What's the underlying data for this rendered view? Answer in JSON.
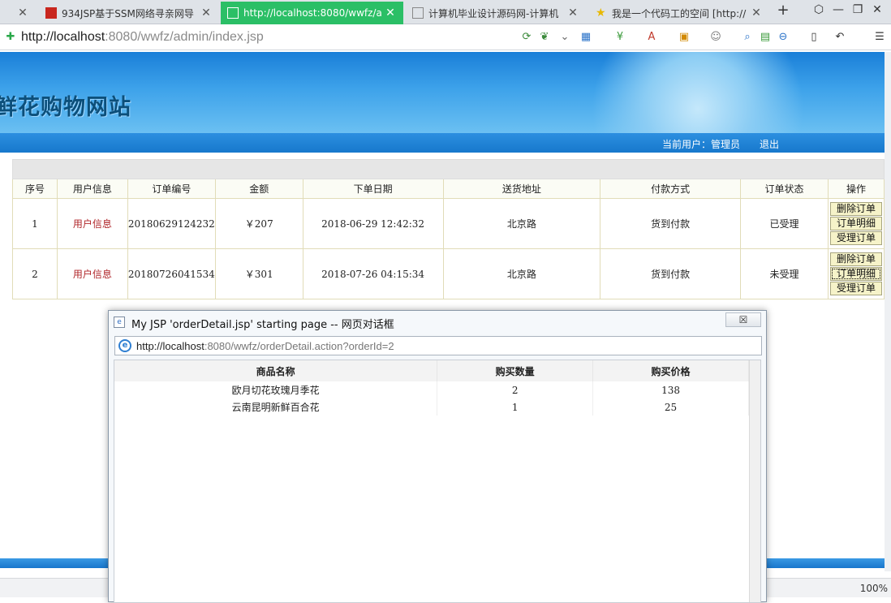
{
  "browser": {
    "tabs": [
      {
        "label": "934JSP基于SSM网络寻亲网导",
        "active": false
      },
      {
        "label": "http://localhost:8080/wwfz/a",
        "active": true
      },
      {
        "label": "计算机毕业设计源码网-计算机",
        "active": false
      },
      {
        "label": "我是一个代码工的空间 [http://",
        "active": false
      }
    ],
    "new_tab": "+",
    "address_host": "http://localhost",
    "address_rest": ":8080/wwfz/admin/index.jsp",
    "zoom": "100%"
  },
  "site": {
    "title": "鲜花购物网站",
    "current_user_label": "当前用户：管理员",
    "logout": "退出"
  },
  "orders": {
    "columns": [
      "序号",
      "用户信息",
      "订单编号",
      "金额",
      "下单日期",
      "送货地址",
      "付款方式",
      "订单状态",
      "操作"
    ],
    "rows": [
      {
        "no": "1",
        "user": "用户信息",
        "order_no": "20180629124232",
        "amount": "￥207",
        "date": "2018-06-29 12:42:32",
        "address": "北京路",
        "payment": "货到付款",
        "status": "已受理"
      },
      {
        "no": "2",
        "user": "用户信息",
        "order_no": "20180726041534",
        "amount": "￥301",
        "date": "2018-07-26 04:15:34",
        "address": "北京路",
        "payment": "货到付款",
        "status": "未受理"
      }
    ],
    "actions": {
      "delete": "删除订单",
      "detail": "订单明细",
      "accept": "受理订单"
    }
  },
  "dialog": {
    "title": "My JSP 'orderDetail.jsp' starting page -- 网页对话框",
    "close": "☒",
    "url_host": "http://localhost",
    "url_rest": ":8080/wwfz/orderDetail.action?orderId=2",
    "columns": [
      "商品名称",
      "购买数量",
      "购买价格"
    ],
    "rows": [
      {
        "name": "欧月切花玫瑰月季花",
        "qty": "2",
        "price": "138"
      },
      {
        "name": "云南昆明新鲜百合花",
        "qty": "1",
        "price": "25"
      }
    ]
  },
  "colors": {
    "accent": "#2bbf66",
    "header_blue": "#1a7fd8",
    "link_red": "#b0262a"
  }
}
